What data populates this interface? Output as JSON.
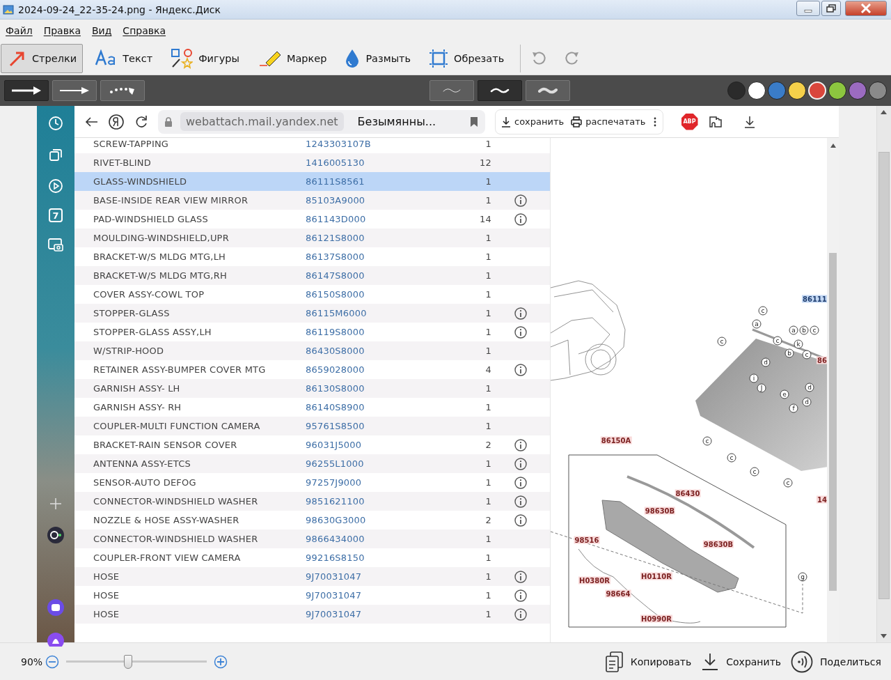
{
  "window": {
    "title": "2024-09-24_22-35-24.png - Яндекс.Диск"
  },
  "menu": [
    "Файл",
    "Правка",
    "Вид",
    "Справка"
  ],
  "tools": [
    {
      "kind": "arrows",
      "label": "Стрелки",
      "selected": true
    },
    {
      "kind": "text",
      "label": "Текст",
      "selected": false
    },
    {
      "kind": "shapes",
      "label": "Фигуры",
      "selected": false
    },
    {
      "kind": "marker",
      "label": "Маркер",
      "selected": false
    },
    {
      "kind": "blur",
      "label": "Размыть",
      "selected": false
    },
    {
      "kind": "crop",
      "label": "Обрезать",
      "selected": false
    }
  ],
  "arrow_styles": [
    {
      "kind": "thick",
      "selected": true
    },
    {
      "kind": "thin",
      "selected": false
    },
    {
      "kind": "dotted",
      "selected": false
    }
  ],
  "line_widths": [
    {
      "selected": false
    },
    {
      "selected": true
    },
    {
      "selected": false
    }
  ],
  "colors": [
    {
      "color": "#2b2b2b",
      "selected": false
    },
    {
      "color": "#ffffff",
      "selected": false
    },
    {
      "color": "#3a7cc8",
      "selected": false
    },
    {
      "color": "#f5d04a",
      "selected": false
    },
    {
      "color": "#d9463c",
      "selected": true
    },
    {
      "color": "#8cc63f",
      "selected": false
    },
    {
      "color": "#9b6bc0",
      "selected": false
    },
    {
      "color": "#8a8a8a",
      "selected": false
    }
  ],
  "browser": {
    "calendar_day": "7",
    "address": "webattach.mail.yandex.net",
    "tab_title": "Безымянны...",
    "actions": [
      "сохранить",
      "распечатать"
    ],
    "extension_badge": "ABP"
  },
  "parts_table": {
    "rows": [
      {
        "name": "SCREW-TAPPING",
        "number": "1243303107B",
        "qty": "1",
        "info": false,
        "selected": false
      },
      {
        "name": "RIVET-BLIND",
        "number": "1416005130",
        "qty": "12",
        "info": false,
        "selected": false
      },
      {
        "name": "GLASS-WINDSHIELD",
        "number": "86111S8561",
        "qty": "1",
        "info": false,
        "selected": true
      },
      {
        "name": "BASE-INSIDE REAR VIEW MIRROR",
        "number": "85103A9000",
        "qty": "1",
        "info": true,
        "selected": false
      },
      {
        "name": "PAD-WINDSHIELD GLASS",
        "number": "861143D000",
        "qty": "14",
        "info": true,
        "selected": false
      },
      {
        "name": "MOULDING-WINDSHIELD,UPR",
        "number": "86121S8000",
        "qty": "1",
        "info": false,
        "selected": false
      },
      {
        "name": "BRACKET-W/S MLDG MTG,LH",
        "number": "86137S8000",
        "qty": "1",
        "info": false,
        "selected": false
      },
      {
        "name": "BRACKET-W/S MLDG MTG,RH",
        "number": "86147S8000",
        "qty": "1",
        "info": false,
        "selected": false
      },
      {
        "name": "COVER ASSY-COWL TOP",
        "number": "86150S8000",
        "qty": "1",
        "info": false,
        "selected": false
      },
      {
        "name": "STOPPER-GLASS",
        "number": "86115M6000",
        "qty": "1",
        "info": true,
        "selected": false
      },
      {
        "name": "STOPPER-GLASS ASSY,LH",
        "number": "86119S8000",
        "qty": "1",
        "info": true,
        "selected": false
      },
      {
        "name": "W/STRIP-HOOD",
        "number": "86430S8000",
        "qty": "1",
        "info": false,
        "selected": false
      },
      {
        "name": "RETAINER ASSY-BUMPER COVER MTG",
        "number": "8659028000",
        "qty": "4",
        "info": true,
        "selected": false
      },
      {
        "name": "GARNISH ASSY- LH",
        "number": "86130S8000",
        "qty": "1",
        "info": false,
        "selected": false
      },
      {
        "name": "GARNISH ASSY- RH",
        "number": "86140S8900",
        "qty": "1",
        "info": false,
        "selected": false
      },
      {
        "name": "COUPLER-MULTI FUNCTION CAMERA",
        "number": "95761S8500",
        "qty": "1",
        "info": false,
        "selected": false
      },
      {
        "name": "BRACKET-RAIN SENSOR COVER",
        "number": "96031J5000",
        "qty": "2",
        "info": true,
        "selected": false
      },
      {
        "name": "ANTENNA ASSY-ETCS",
        "number": "96255L1000",
        "qty": "1",
        "info": true,
        "selected": false
      },
      {
        "name": "SENSOR-AUTO DEFOG",
        "number": "97257J9000",
        "qty": "1",
        "info": true,
        "selected": false
      },
      {
        "name": "CONNECTOR-WINDSHIELD WASHER",
        "number": "9851621100",
        "qty": "1",
        "info": true,
        "selected": false
      },
      {
        "name": "NOZZLE & HOSE ASSY-WASHER",
        "number": "98630G3000",
        "qty": "2",
        "info": true,
        "selected": false
      },
      {
        "name": "CONNECTOR-WINDSHIELD WASHER",
        "number": "9866434000",
        "qty": "1",
        "info": false,
        "selected": false
      },
      {
        "name": "COUPLER-FRONT VIEW CAMERA",
        "number": "99216S8150",
        "qty": "1",
        "info": false,
        "selected": false
      },
      {
        "name": "HOSE",
        "number": "9J70031047",
        "qty": "1",
        "info": true,
        "selected": false
      },
      {
        "name": "HOSE",
        "number": "9J70031047",
        "qty": "1",
        "info": true,
        "selected": false
      },
      {
        "name": "HOSE",
        "number": "9J70031047",
        "qty": "1",
        "info": true,
        "selected": false
      }
    ]
  },
  "diagram": {
    "labels": [
      {
        "text": "86111",
        "selected": true
      },
      {
        "text": "86",
        "selected": false
      },
      {
        "text": "14",
        "selected": false
      },
      {
        "text": "86150A",
        "selected": false
      },
      {
        "text": "86430",
        "selected": false
      },
      {
        "text": "98630B",
        "selected": false
      },
      {
        "text": "98630B",
        "selected": false
      },
      {
        "text": "98516",
        "selected": false
      },
      {
        "text": "H0380R",
        "selected": false
      },
      {
        "text": "H0110R",
        "selected": false
      },
      {
        "text": "98664",
        "selected": false
      },
      {
        "text": "H0990R",
        "selected": false
      }
    ],
    "callouts": [
      "c",
      "a",
      "a",
      "b",
      "c",
      "c",
      "c",
      "k",
      "b",
      "c",
      "d",
      "i",
      "J",
      "e",
      "d",
      "d",
      "f",
      "c",
      "c",
      "c",
      "c",
      "g"
    ]
  },
  "zoom": {
    "value": "90%",
    "level": 0.44
  },
  "bottom_actions": [
    "Копировать",
    "Сохранить",
    "Поделиться"
  ]
}
